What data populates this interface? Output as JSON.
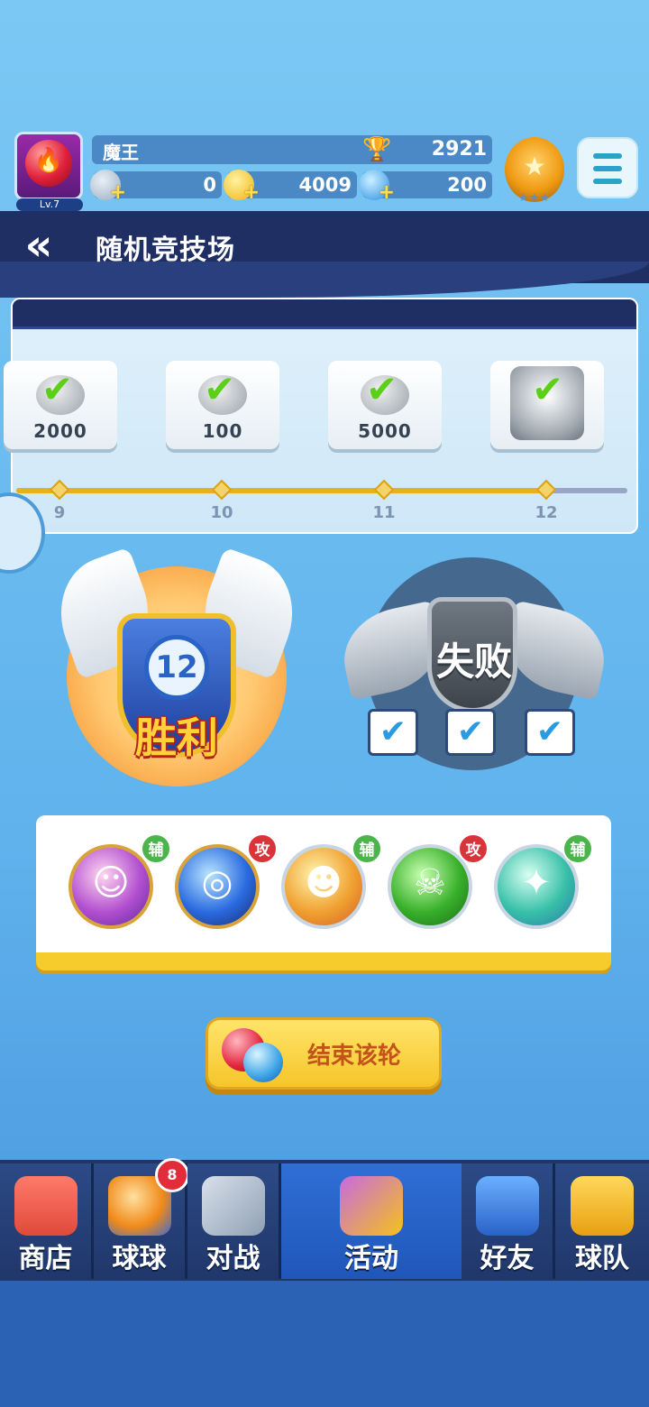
{
  "player": {
    "name": "魔王",
    "level": "Lv.7"
  },
  "stats": {
    "trophies": "2921",
    "stars": "0",
    "coins": "4009",
    "gems": "200"
  },
  "header": {
    "title": "随机竞技场"
  },
  "rewards": [
    {
      "value": "2000",
      "icon": "check-icon",
      "claimed": true
    },
    {
      "value": "100",
      "icon": "check-icon",
      "claimed": true
    },
    {
      "value": "5000",
      "icon": "check-icon",
      "claimed": true
    },
    {
      "value": "",
      "icon": "treasure-chest-icon",
      "claimed": true
    }
  ],
  "progress": {
    "labels": [
      "9",
      "10",
      "11",
      "12"
    ]
  },
  "result": {
    "wins": "12",
    "win_label": "胜利",
    "lose_label": "失败",
    "losses": 3
  },
  "skills": [
    {
      "icon": "ghost-skill-icon",
      "tag": "辅"
    },
    {
      "icon": "vortex-skill-icon",
      "tag": "攻"
    },
    {
      "icon": "fire-skill-icon",
      "tag": "辅"
    },
    {
      "icon": "skull-skill-icon",
      "tag": "攻"
    },
    {
      "icon": "sp-skill-icon",
      "tag": "辅"
    }
  ],
  "end_button": {
    "label": "结束该轮"
  },
  "nav": {
    "items": [
      {
        "label": "商店",
        "icon": "shop-icon"
      },
      {
        "label": "球球",
        "icon": "balls-icon",
        "badge": "8"
      },
      {
        "label": "对战",
        "icon": "swords-icon"
      },
      {
        "label": "活动",
        "icon": "party-icon",
        "active": true
      },
      {
        "label": "好友",
        "icon": "friends-icon"
      },
      {
        "label": "球队",
        "icon": "whistle-icon"
      }
    ]
  },
  "colors": {
    "accent_blue": "#2f6fd6",
    "gold": "#f6c52a",
    "win_red": "#b2211a",
    "assist_green": "#4bb44a",
    "attack_red": "#d8343a"
  }
}
